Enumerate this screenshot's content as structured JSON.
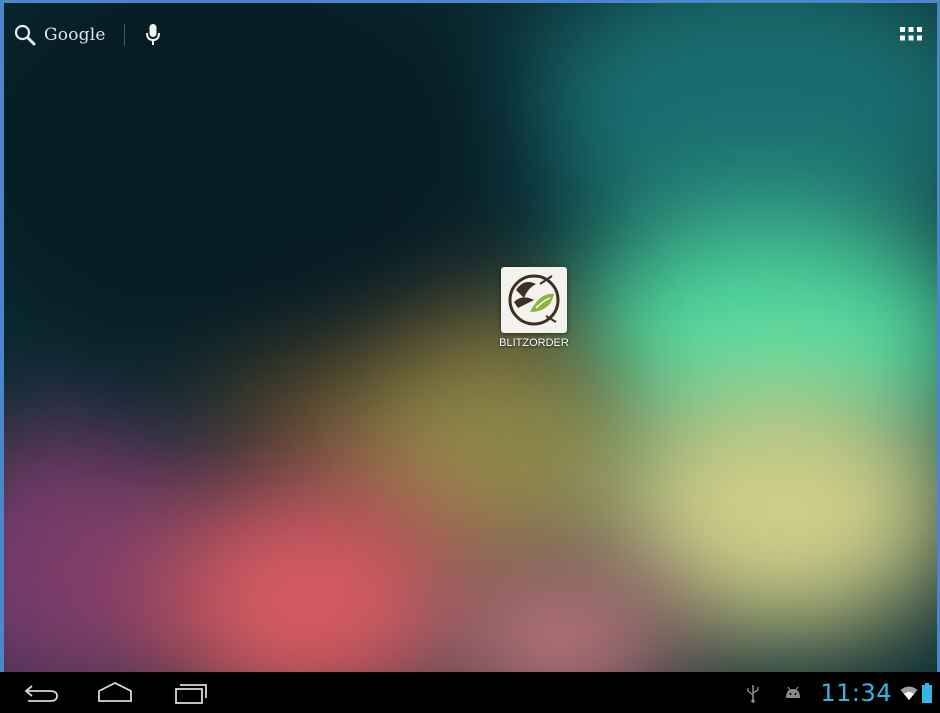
{
  "search_bar": {
    "label": "Google",
    "search_icon": "search-icon",
    "voice_icon": "microphone-icon"
  },
  "apps_button": {
    "icon": "all-apps-grid-icon"
  },
  "desktop_shortcuts": [
    {
      "label": "BLITZORDER",
      "icon": "blitzorder-app-icon"
    }
  ],
  "navigation_bar": {
    "buttons": [
      {
        "name": "back",
        "icon": "back-icon"
      },
      {
        "name": "home",
        "icon": "home-icon"
      },
      {
        "name": "recent-apps",
        "icon": "recent-apps-icon"
      }
    ]
  },
  "status_bar": {
    "time": "11:34",
    "icons": [
      "usb-debugging-icon",
      "android-debug-icon",
      "wifi-icon",
      "battery-icon"
    ],
    "accent_color": "#33b5e5"
  },
  "wallpaper": {
    "colors": [
      "#061c24",
      "#1a6e70",
      "#4fd9a0",
      "#5e4a2a",
      "#cfcf88",
      "#7a3c6a",
      "#d65a62"
    ]
  }
}
